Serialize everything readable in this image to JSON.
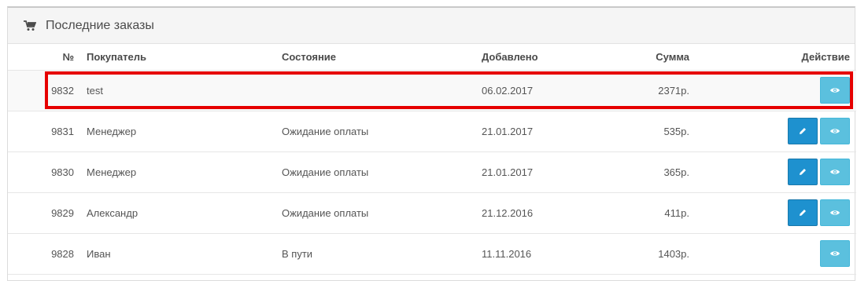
{
  "panel": {
    "title": "Последние заказы",
    "icon": "shopping-cart-icon"
  },
  "table": {
    "headers": {
      "id": "№",
      "customer": "Покупатель",
      "status": "Состояние",
      "date": "Добавлено",
      "total": "Сумма",
      "action": "Действие"
    },
    "rows": [
      {
        "id": "9832",
        "customer": "test",
        "status": "",
        "date": "06.02.2017",
        "total": "2371р."
      },
      {
        "id": "9831",
        "customer": "Менеджер",
        "status": "Ожидание оплаты",
        "date": "21.01.2017",
        "total": "535р."
      },
      {
        "id": "9830",
        "customer": "Менеджер",
        "status": "Ожидание оплаты",
        "date": "21.01.2017",
        "total": "365р."
      },
      {
        "id": "9829",
        "customer": "Александр",
        "status": "Ожидание оплаты",
        "date": "21.12.2016",
        "total": "411р."
      },
      {
        "id": "9828",
        "customer": "Иван",
        "status": "В пути",
        "date": "11.11.2016",
        "total": "1403р."
      }
    ]
  },
  "colors": {
    "edit_button": "#1e91cf",
    "view_button": "#5bc0de",
    "highlight": "#e60000"
  },
  "icons": {
    "edit": "pencil-icon",
    "view": "eye-icon"
  }
}
